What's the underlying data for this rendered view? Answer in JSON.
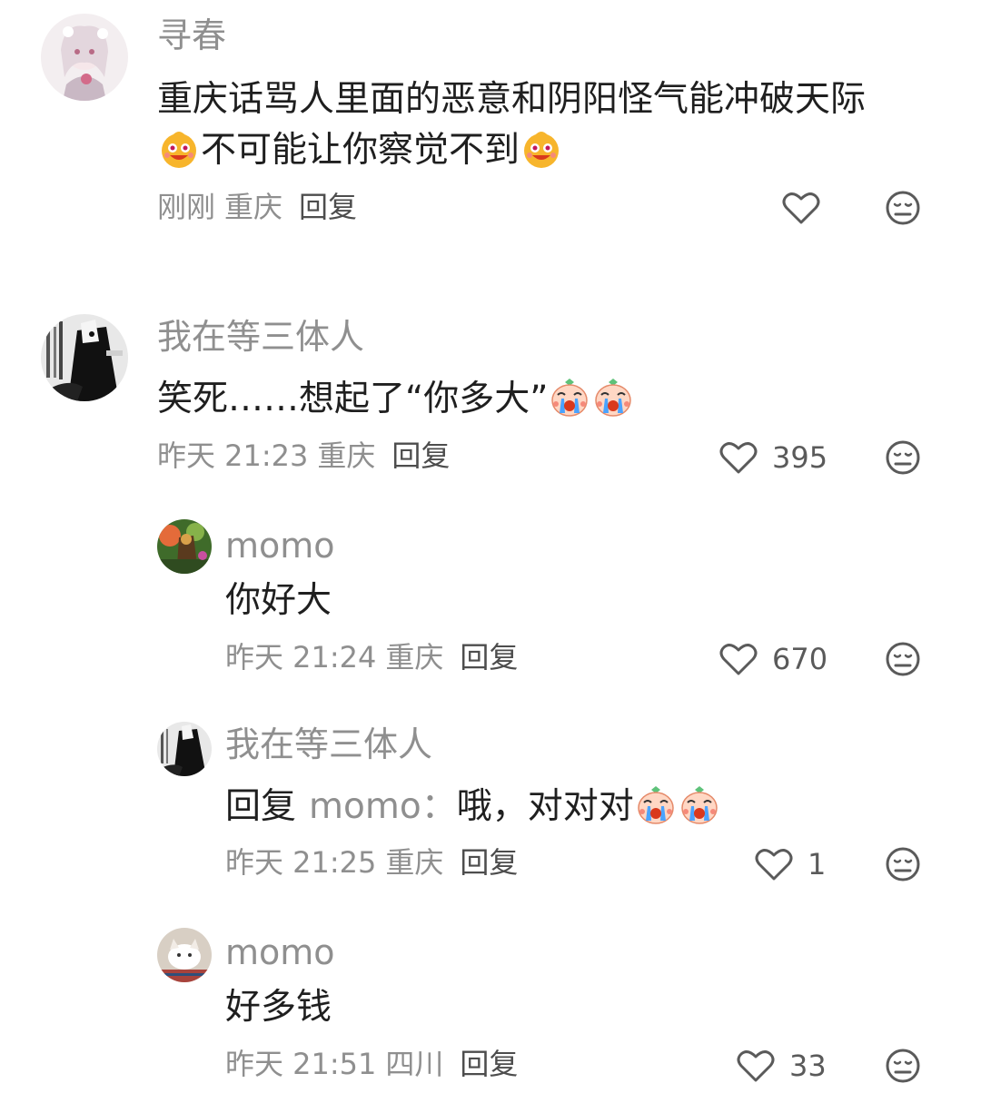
{
  "comments": [
    {
      "username": "寻春",
      "line1": "重庆话骂人里面的恶意和阴阳怪气能冲破天际",
      "line2": "不可能让你察觉不到",
      "time": "刚刚",
      "location": "重庆",
      "reply_label": "回复",
      "like_count": "",
      "avatar_icon": "anime-girl-avatar",
      "emoji_icon": "grinning-face-emoji"
    },
    {
      "username": "我在等三体人",
      "text": "笑死……想起了“你多大”",
      "time": "昨天 21:23",
      "location": "重庆",
      "reply_label": "回复",
      "like_count": "395",
      "avatar_icon": "monochrome-manga-avatar",
      "emoji_icon": "crying-face-emoji"
    },
    {
      "username": "momo",
      "text": "你好大",
      "time": "昨天 21:24",
      "location": "重庆",
      "reply_label": "回复",
      "like_count": "670",
      "avatar_icon": "colorful-landscape-avatar"
    },
    {
      "username": "我在等三体人",
      "reply_prefix": "回复",
      "reply_target": "momo：",
      "text": "哦，对对对",
      "time": "昨天 21:25",
      "location": "重庆",
      "reply_label": "回复",
      "like_count": "1",
      "avatar_icon": "monochrome-manga-avatar",
      "emoji_icon": "crying-face-emoji"
    },
    {
      "username": "momo",
      "text": "好多钱",
      "time": "昨天 21:51",
      "location": "四川",
      "reply_label": "回复",
      "like_count": "33",
      "avatar_icon": "white-cat-avatar"
    }
  ],
  "icons": {
    "like": "heart-outline-icon",
    "dislike": "meh-face-icon"
  },
  "colors": {
    "username": "#8f8f8f",
    "text": "#1f1f1f",
    "meta": "#8f8f8f",
    "icon": "#5a5a5a"
  }
}
